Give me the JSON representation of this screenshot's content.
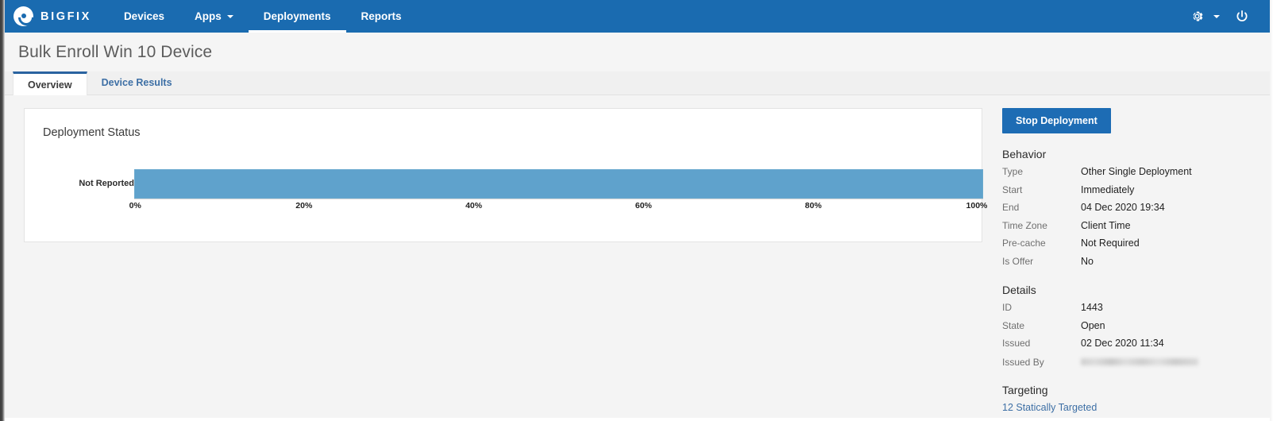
{
  "navbar": {
    "brand_label": "BIGFIX",
    "brand_icon": "bigfix-logo-icon",
    "items": [
      {
        "label": "Devices",
        "active": false,
        "has_caret": false
      },
      {
        "label": "Apps",
        "active": false,
        "has_caret": true
      },
      {
        "label": "Deployments",
        "active": true,
        "has_caret": false
      },
      {
        "label": "Reports",
        "active": false,
        "has_caret": false
      }
    ],
    "settings_icon": "gear-icon",
    "settings_caret_icon": "chevron-down-icon",
    "power_icon": "power-icon"
  },
  "page": {
    "title": "Bulk Enroll Win 10 Device"
  },
  "tabs": [
    {
      "label": "Overview",
      "active": true
    },
    {
      "label": "Device Results",
      "active": false
    }
  ],
  "chart_data": {
    "type": "bar",
    "orientation": "horizontal",
    "title": "Deployment Status",
    "categories": [
      "Not Reported"
    ],
    "values": [
      100
    ],
    "series": [
      {
        "name": "Not Reported",
        "values": [
          100
        ],
        "color": "#5fa2cc"
      }
    ],
    "xlabel": "",
    "ylabel": "",
    "xlim": [
      0,
      100
    ],
    "x_ticks": [
      "0%",
      "20%",
      "40%",
      "60%",
      "80%",
      "100%"
    ],
    "x_tick_values": [
      0,
      20,
      40,
      60,
      80,
      100
    ],
    "grid": false,
    "legend": "none",
    "unit": "%"
  },
  "side_panel": {
    "stop_button_label": "Stop Deployment",
    "behavior": {
      "heading": "Behavior",
      "rows": [
        {
          "key": "Type",
          "value": "Other Single Deployment"
        },
        {
          "key": "Start",
          "value": "Immediately"
        },
        {
          "key": "End",
          "value": "04 Dec 2020 19:34"
        },
        {
          "key": "Time Zone",
          "value": "Client Time"
        },
        {
          "key": "Pre-cache",
          "value": "Not Required"
        },
        {
          "key": "Is Offer",
          "value": "No"
        }
      ]
    },
    "details": {
      "heading": "Details",
      "rows": [
        {
          "key": "ID",
          "value": "1443"
        },
        {
          "key": "State",
          "value": "Open"
        },
        {
          "key": "Issued",
          "value": "02 Dec 2020 11:34"
        }
      ],
      "issued_by_key": "Issued By",
      "issued_by_value_redacted": true
    },
    "targeting": {
      "heading": "Targeting",
      "link_label": "12 Statically Targeted"
    }
  },
  "colors": {
    "navbar_blue": "#1a6bb0",
    "accent_blue": "#1d6cb4",
    "bar_blue": "#5fa2cc",
    "link_blue": "#3d6fa5",
    "page_bg": "#f4f4f4"
  }
}
